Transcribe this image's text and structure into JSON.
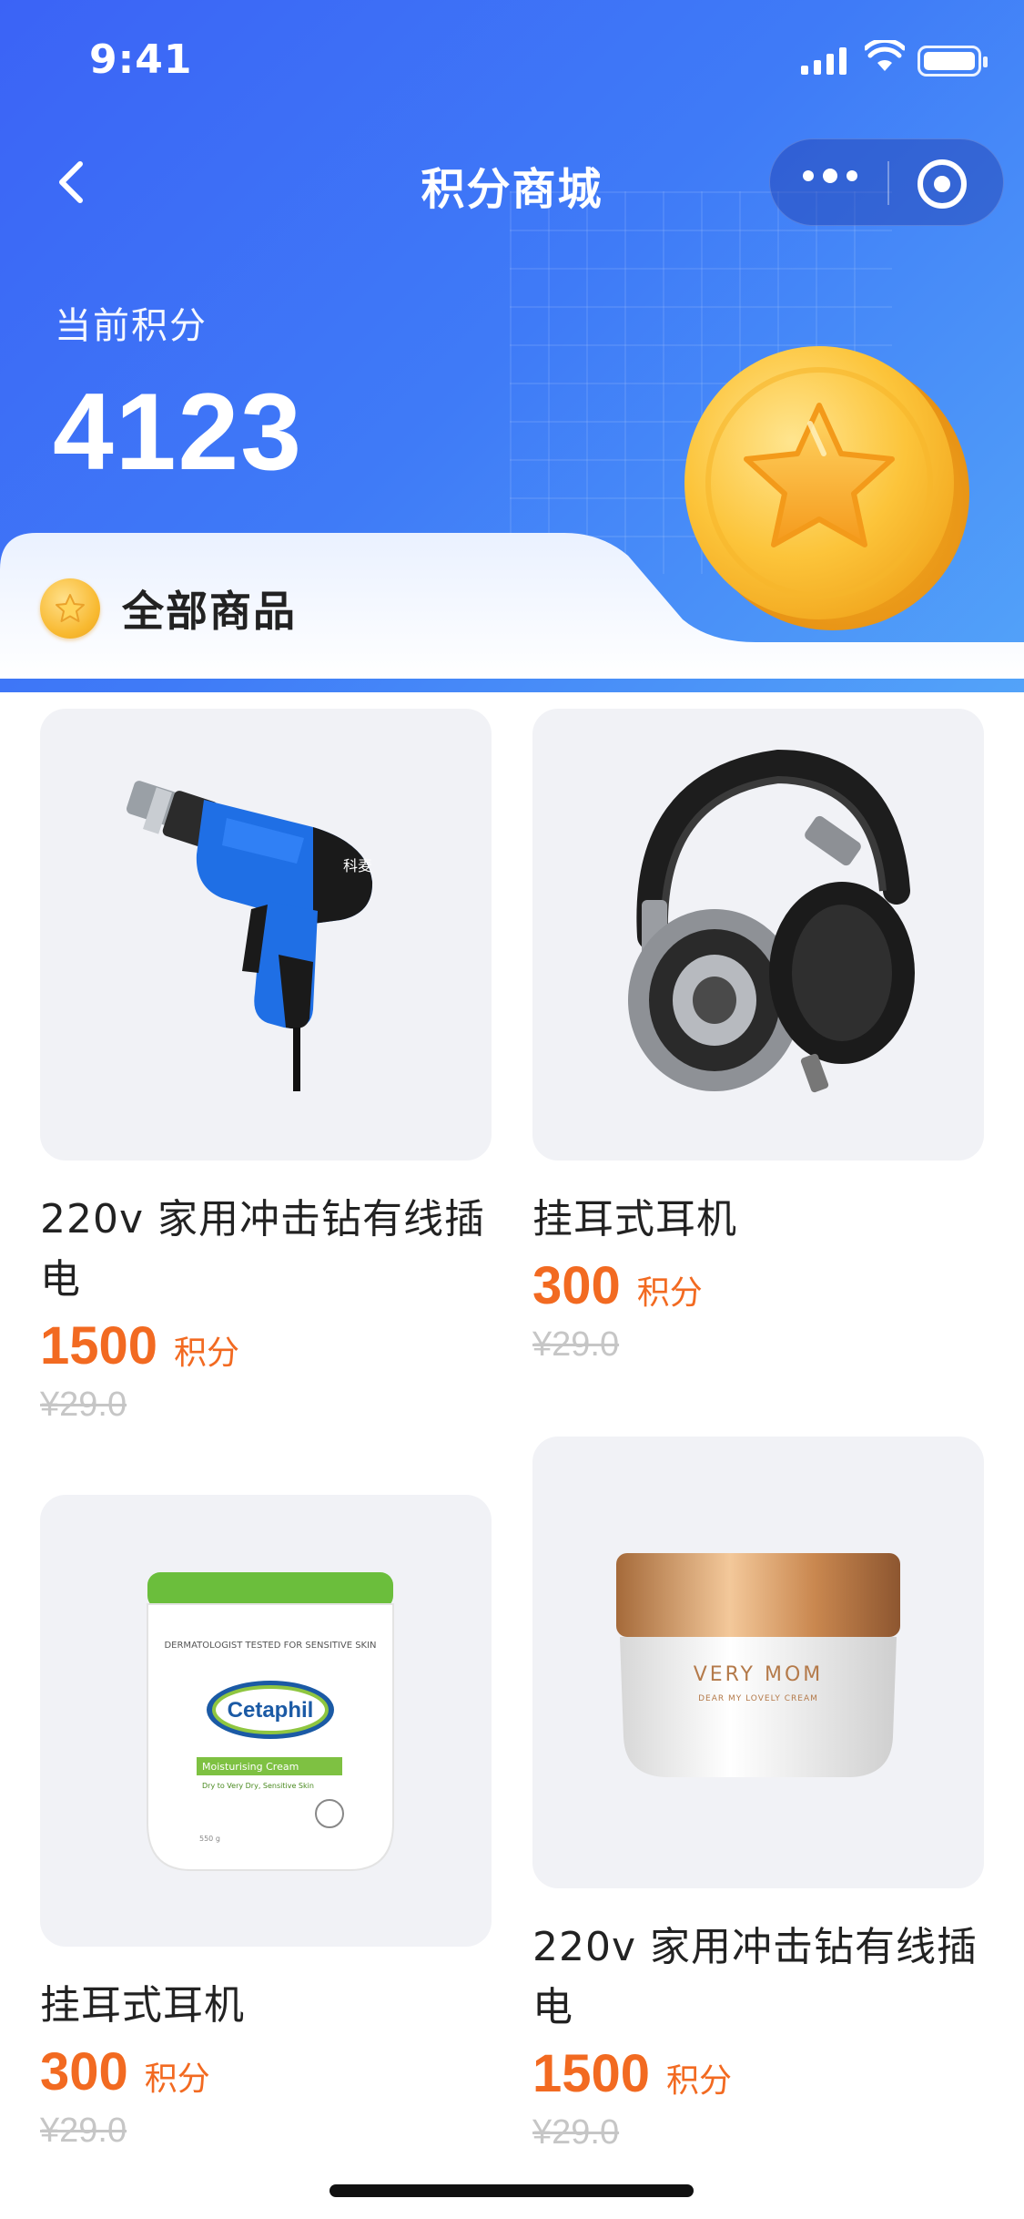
{
  "status_bar": {
    "time": "9:41"
  },
  "nav": {
    "title": "积分商城"
  },
  "points": {
    "label": "当前积分",
    "value": "4123"
  },
  "section": {
    "title": "全部商品"
  },
  "products": [
    {
      "name": "220v 家用冲击钻有线插电",
      "points": "1500",
      "unit": "积分",
      "original_price": "¥29.0",
      "image": "drill"
    },
    {
      "name": "挂耳式耳机",
      "points": "300",
      "unit": "积分",
      "original_price": "¥29.0",
      "image": "headphones"
    },
    {
      "name": "挂耳式耳机",
      "points": "300",
      "unit": "积分",
      "original_price": "¥29.0",
      "image": "cream-jar"
    },
    {
      "name": "220v 家用冲击钻有线插电",
      "points": "1500",
      "unit": "积分",
      "original_price": "¥29.0",
      "image": "cosmetic-jar"
    }
  ],
  "product_images": {
    "cream_brand": "Cetaphil",
    "cream_top": "DERMATOLOGIST TESTED FOR SENSITIVE SKIN",
    "cream_label": "Moisturising Cream",
    "cream_sub": "Dry to Very Dry, Sensitive Skin",
    "cream_weight": "550 g",
    "jar_brand": "VERY MOM",
    "jar_sub": "DEAR MY LOVELY CREAM",
    "drill_brand": "科麦"
  },
  "colors": {
    "accent": "#f26a21",
    "hero_start": "#3b63f6",
    "hero_end": "#53a3f9",
    "card_bg": "#f1f2f6"
  }
}
